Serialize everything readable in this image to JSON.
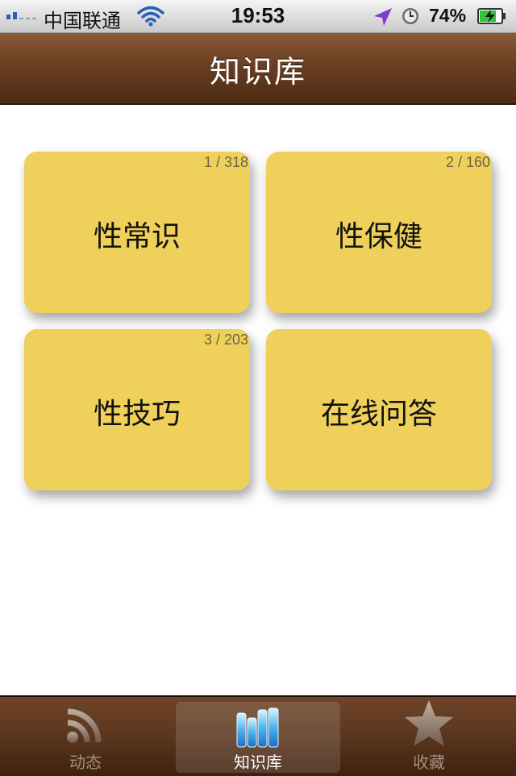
{
  "status_bar": {
    "carrier": "中国联通",
    "time": "19:53",
    "battery_percent": "74%",
    "signal_bars": 2,
    "icons": [
      "signal-icon",
      "wifi-icon",
      "location-arrow-icon",
      "clock-icon",
      "battery-charging-icon"
    ]
  },
  "nav": {
    "title": "知识库"
  },
  "tiles": [
    {
      "label": "性常识",
      "count": "1 / 318"
    },
    {
      "label": "性保健",
      "count": "2 / 160"
    },
    {
      "label": "性技巧",
      "count": "3 / 203"
    },
    {
      "label": "在线问答",
      "count": ""
    }
  ],
  "tab_bar": {
    "items": [
      {
        "label": "动态",
        "icon": "rss-icon",
        "selected": false
      },
      {
        "label": "知识库",
        "icon": "books-icon",
        "selected": true
      },
      {
        "label": "收藏",
        "icon": "star-icon",
        "selected": false
      }
    ]
  },
  "colors": {
    "tile_bg": "#efd05a",
    "nav_brown": "#6a3f22",
    "tab_inactive": "#a48f80"
  }
}
